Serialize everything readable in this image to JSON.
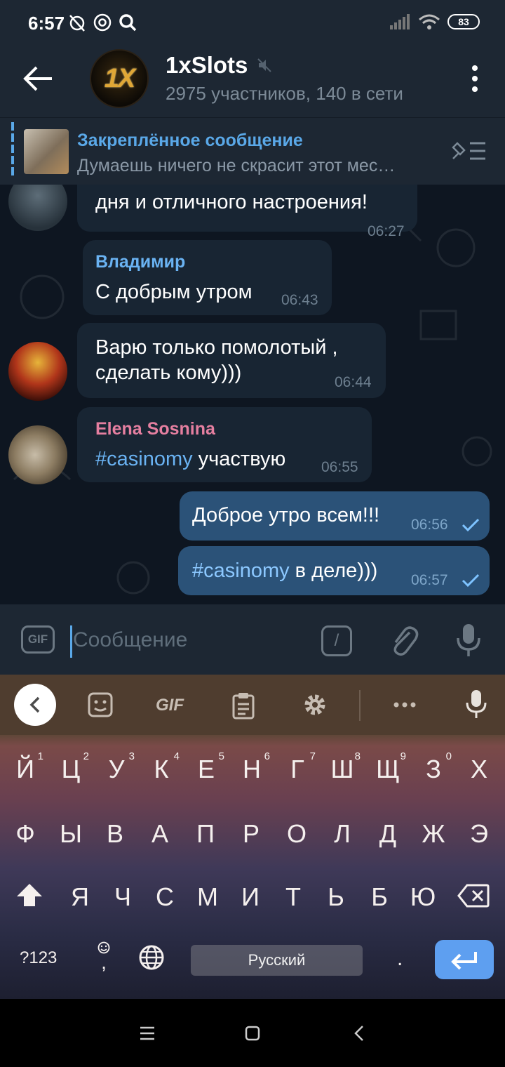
{
  "status_bar": {
    "time": "6:57",
    "battery": "83"
  },
  "header": {
    "avatar_text": "1X",
    "title": "1xSlots",
    "subtitle": "2975 участников, 140 в сети"
  },
  "pinned": {
    "title": "Закреплённое сообщение",
    "text": "Думаешь ничего не скрасит этот мес…"
  },
  "messages": [
    {
      "text": "дня и отличного настроения!",
      "time": "06:27"
    },
    {
      "sender": "Владимир",
      "text": "С добрым утром",
      "time": "06:43"
    },
    {
      "text_line1": "Варю только помолотый ,",
      "text_line2": "сделать кому)))",
      "time": "06:44"
    },
    {
      "sender": "Elena Sosnina",
      "hashtag": "#casinomy",
      "text": " участвую",
      "time": "06:55"
    },
    {
      "text": "Доброе утро всем!!!",
      "time": "06:56"
    },
    {
      "hashtag": "#casinomy",
      "text": " в деле)))",
      "time": "06:57"
    }
  ],
  "colors": {
    "sender_blue": "#6ab3f3",
    "sender_pink": "#e57fa0",
    "accent": "#5aa8e8"
  },
  "input": {
    "placeholder": "Сообщение",
    "gif_label": "GIF",
    "command_label": "/"
  },
  "keyboard": {
    "toolbar_gif": "GIF",
    "row1": [
      "Й",
      "Ц",
      "У",
      "К",
      "Е",
      "Н",
      "Г",
      "Ш",
      "Щ",
      "З",
      "Х"
    ],
    "row1_hints": [
      "1",
      "2",
      "3",
      "4",
      "5",
      "6",
      "7",
      "8",
      "9",
      "0",
      ""
    ],
    "row2": [
      "Ф",
      "Ы",
      "В",
      "А",
      "П",
      "Р",
      "О",
      "Л",
      "Д",
      "Ж",
      "Э"
    ],
    "row3": [
      "Я",
      "Ч",
      "С",
      "М",
      "И",
      "Т",
      "Ь",
      "Б",
      "Ю"
    ],
    "symbols_key": "?123",
    "comma_key": ",",
    "period_key": ".",
    "space_label": "Русский"
  }
}
